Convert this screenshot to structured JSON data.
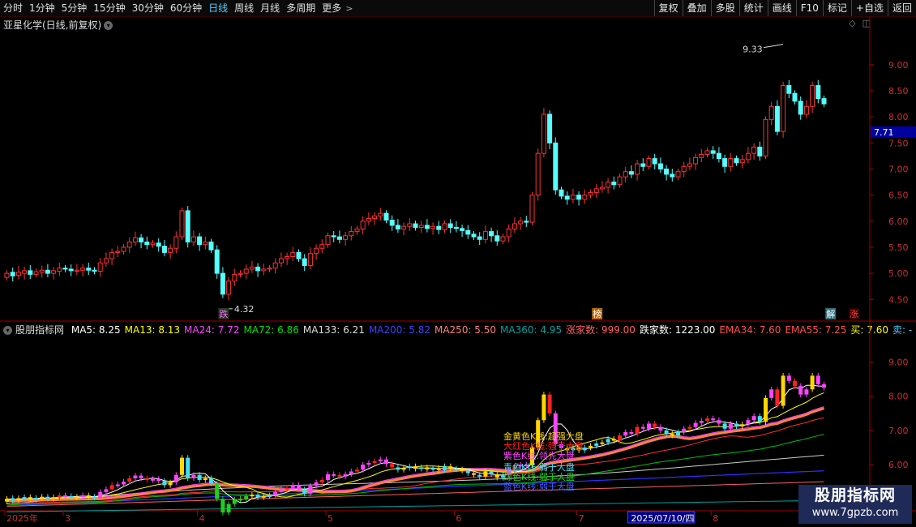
{
  "toolbar": {
    "timeframes": [
      "分时",
      "1分钟",
      "5分钟",
      "15分钟",
      "30分钟",
      "60分钟",
      "日线",
      "周线",
      "月线",
      "多周期",
      "更多"
    ],
    "active_index": 6,
    "right_buttons": [
      "复权",
      "叠加",
      "多股",
      "统计",
      "画线",
      "F10",
      "标记",
      "+自选",
      "返回"
    ]
  },
  "main_title": "亚星化学(日线,前复权)",
  "indicator_title": "股朋指标网",
  "indicator_values": [
    {
      "label": "MA5: 8.25",
      "color": "#ffffff"
    },
    {
      "label": "MA13: 8.13",
      "color": "#ffff00"
    },
    {
      "label": "MA24: 7.72",
      "color": "#ff44ff"
    },
    {
      "label": "MA72: 6.86",
      "color": "#00e000"
    },
    {
      "label": "MA133: 6.21",
      "color": "#dddddd"
    },
    {
      "label": "MA200: 5.82",
      "color": "#4040ff"
    },
    {
      "label": "MA250: 5.50",
      "color": "#ff8080"
    },
    {
      "label": "MA360: 4.95",
      "color": "#00a0a0"
    },
    {
      "label": "涨家数: 999.00",
      "color": "#ff6060"
    },
    {
      "label": "跌家数: 1223.00",
      "color": "#ffffff"
    },
    {
      "label": "EMA34: 7.60",
      "color": "#ff5050"
    },
    {
      "label": "EMA55: 7.25",
      "color": "#ff5050"
    },
    {
      "label": "买: 7.60",
      "color": "#ffff00"
    },
    {
      "label": "卖: -",
      "color": "#44ccff"
    }
  ],
  "price_axis": {
    "ticks": [
      9.0,
      8.5,
      8.0,
      7.5,
      7.0,
      6.5,
      6.0,
      5.5,
      5.0,
      4.5
    ],
    "range": [
      4.1,
      9.65
    ],
    "current": "7.71"
  },
  "lower_axis": {
    "ticks": [
      9.0,
      8.0,
      7.0,
      6.0,
      5.0
    ],
    "range": [
      4.65,
      9.7
    ]
  },
  "annotations": {
    "high": "9.33",
    "low": "4.32"
  },
  "event_tags": [
    {
      "text": "跌",
      "index": 37,
      "color": "#ff66ff",
      "bg": "#1c3a1c"
    },
    {
      "text": "榜",
      "index": 101,
      "color": "#ffffff",
      "bg": "#b86400"
    },
    {
      "text": "解",
      "index": 141,
      "color": "#ffffff",
      "bg": "#2f6f7a"
    },
    {
      "text": "涨",
      "index": 145,
      "color": "#ff4040",
      "bg": "#2a0000"
    }
  ],
  "legend": [
    {
      "text": "金黄色K线:超强大盘",
      "color": "#ffd700"
    },
    {
      "text": "大红色K线:强于大盘",
      "color": "#ff2020"
    },
    {
      "text": "紫色K线:领先大盘",
      "color": "#ff44ff"
    },
    {
      "text": "青色K线:弱于大盘",
      "color": "#40e0f0"
    },
    {
      "text": "绿色K线:弱于大盘",
      "color": "#20d020"
    },
    {
      "text": "蓝色K线:弱于大盘",
      "color": "#4060ff"
    }
  ],
  "x_axis": {
    "labels": [
      {
        "text": "2025年",
        "index": 0
      },
      {
        "text": "3",
        "index": 10
      },
      {
        "text": "4",
        "index": 33
      },
      {
        "text": "5",
        "index": 55
      },
      {
        "text": "6",
        "index": 77
      },
      {
        "text": "7",
        "index": 98
      },
      {
        "text": "2025/07/10/四",
        "index": 107,
        "highlight": true
      },
      {
        "text": "8",
        "index": 121
      }
    ]
  },
  "logo": {
    "title": "股朋指标网",
    "url": "www.7gpzb.com"
  },
  "chart_data": {
    "type": "candlestick",
    "closes": [
      5.0,
      4.95,
      5.02,
      5.05,
      4.98,
      5.03,
      5.06,
      5.0,
      5.05,
      5.1,
      5.08,
      5.05,
      5.06,
      5.1,
      5.06,
      5.04,
      5.2,
      5.28,
      5.4,
      5.42,
      5.5,
      5.6,
      5.68,
      5.6,
      5.55,
      5.58,
      5.52,
      5.4,
      5.48,
      5.7,
      6.2,
      5.6,
      5.7,
      5.55,
      5.6,
      5.45,
      5.0,
      4.6,
      4.85,
      4.98,
      5.0,
      5.08,
      5.12,
      5.05,
      5.08,
      5.1,
      5.2,
      5.28,
      5.32,
      5.4,
      5.28,
      5.15,
      5.38,
      5.48,
      5.55,
      5.72,
      5.7,
      5.65,
      5.72,
      5.8,
      5.85,
      6.0,
      6.05,
      6.1,
      6.15,
      6.02,
      5.92,
      5.85,
      5.9,
      5.95,
      5.88,
      5.92,
      5.86,
      5.9,
      5.84,
      5.95,
      5.88,
      5.86,
      5.82,
      5.75,
      5.7,
      5.65,
      5.8,
      5.72,
      5.62,
      5.7,
      5.85,
      5.95,
      6.0,
      5.98,
      6.5,
      7.3,
      8.05,
      7.5,
      6.6,
      6.48,
      6.42,
      6.5,
      6.42,
      6.5,
      6.55,
      6.62,
      6.65,
      6.75,
      6.7,
      6.85,
      6.95,
      6.9,
      7.1,
      7.05,
      7.2,
      7.1,
      7.0,
      6.9,
      6.85,
      6.95,
      7.05,
      7.1,
      7.22,
      7.28,
      7.35,
      7.3,
      7.2,
      7.05,
      7.2,
      7.12,
      7.18,
      7.3,
      7.42,
      7.25,
      7.95,
      8.2,
      7.72,
      8.6,
      8.45,
      8.3,
      8.05,
      8.2,
      8.6,
      8.35,
      8.25
    ],
    "opens": [
      4.92,
      5.02,
      4.96,
      5.0,
      5.05,
      4.98,
      5.02,
      5.06,
      5.0,
      5.04,
      5.1,
      5.08,
      5.04,
      5.06,
      5.1,
      5.06,
      5.04,
      5.2,
      5.28,
      5.4,
      5.42,
      5.5,
      5.6,
      5.68,
      5.6,
      5.55,
      5.58,
      5.52,
      5.4,
      5.48,
      5.7,
      6.2,
      5.6,
      5.7,
      5.55,
      5.6,
      5.45,
      5.0,
      4.6,
      4.85,
      4.98,
      5.0,
      5.08,
      5.12,
      5.05,
      5.08,
      5.1,
      5.2,
      5.28,
      5.32,
      5.4,
      5.28,
      5.15,
      5.38,
      5.48,
      5.55,
      5.72,
      5.7,
      5.65,
      5.72,
      5.8,
      5.85,
      6.0,
      6.05,
      6.1,
      6.15,
      6.02,
      5.92,
      5.85,
      5.9,
      5.95,
      5.88,
      5.92,
      5.86,
      5.9,
      5.84,
      5.95,
      5.88,
      5.86,
      5.82,
      5.75,
      5.7,
      5.65,
      5.8,
      5.72,
      5.62,
      5.7,
      5.85,
      5.95,
      6.0,
      5.98,
      6.5,
      7.3,
      8.05,
      7.5,
      6.6,
      6.48,
      6.42,
      6.5,
      6.42,
      6.5,
      6.55,
      6.62,
      6.65,
      6.75,
      6.7,
      6.85,
      6.95,
      6.9,
      7.1,
      7.05,
      7.2,
      7.1,
      7.0,
      6.9,
      6.85,
      6.95,
      7.05,
      7.1,
      7.22,
      7.28,
      7.35,
      7.3,
      7.2,
      7.05,
      7.2,
      7.12,
      7.18,
      7.3,
      7.42,
      7.25,
      7.95,
      8.2,
      7.72,
      8.6,
      8.45,
      8.3,
      8.05,
      8.2,
      8.6,
      8.35
    ]
  }
}
